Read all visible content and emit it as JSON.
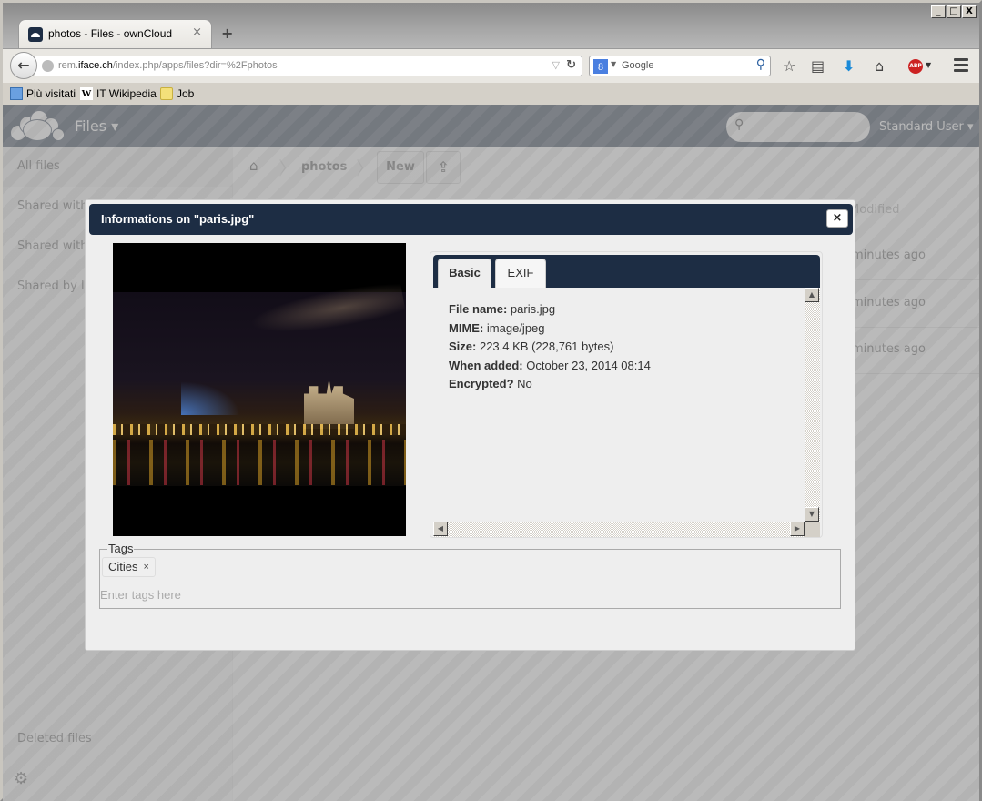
{
  "browser": {
    "tab_title": "photos - Files - ownCloud",
    "tab_close": "×",
    "new_tab": "+",
    "window_buttons": [
      "_",
      "□",
      "X"
    ],
    "url_host": "rem.iface.ch",
    "url_prefix": "rem.",
    "url_domain": "iface.ch",
    "url_path": "/index.php/apps/files?dir=%2Fphotos",
    "search_engine": "Google",
    "search_placeholder": "Google",
    "bookmarks": [
      {
        "label": "Più visitati",
        "icon": "most-visited-icon"
      },
      {
        "label": "IT Wikipedia",
        "icon": "wikipedia-icon"
      },
      {
        "label": "Job",
        "icon": "folder-icon"
      }
    ],
    "toolbar_icons": [
      "bookmark-star-icon",
      "reading-list-icon",
      "download-icon",
      "home-icon",
      "adblock-icon",
      "menu-icon"
    ]
  },
  "app": {
    "name": "Files",
    "user": "Standard User",
    "search_placeholder": ""
  },
  "sidebar": {
    "items": [
      {
        "label": "All files",
        "active": true
      },
      {
        "label": "Shared with you"
      },
      {
        "label": "Shared with others"
      },
      {
        "label": "Shared by link"
      }
    ],
    "bottom_item": "Deleted files"
  },
  "controls": {
    "breadcrumb": [
      "photos"
    ],
    "new_label": "New"
  },
  "file_list": {
    "column_modified": "Modified",
    "rows": [
      {
        "modified": "minutes ago"
      },
      {
        "modified": "minutes ago"
      },
      {
        "modified": "minutes ago"
      }
    ]
  },
  "dialog": {
    "title": "Informations on \"paris.jpg\"",
    "close": "×",
    "tabs": [
      {
        "label": "Basic",
        "active": true
      },
      {
        "label": "EXIF",
        "active": false
      }
    ],
    "basic": [
      {
        "label": "File name:",
        "value": "paris.jpg"
      },
      {
        "label": "MIME:",
        "value": "image/jpeg"
      },
      {
        "label": "Size:",
        "value": "223.4 KB (228,761 bytes)"
      },
      {
        "label": "When added:",
        "value": "October 23, 2014 08:14"
      },
      {
        "label": "Encrypted?",
        "value": "No"
      }
    ],
    "tags": {
      "legend": "Tags",
      "items": [
        {
          "label": "Cities",
          "remove": "×"
        }
      ],
      "input_placeholder": "Enter tags here"
    }
  },
  "colors": {
    "header_bg": "#1d2d44",
    "dialog_bg": "#eeeeee"
  }
}
